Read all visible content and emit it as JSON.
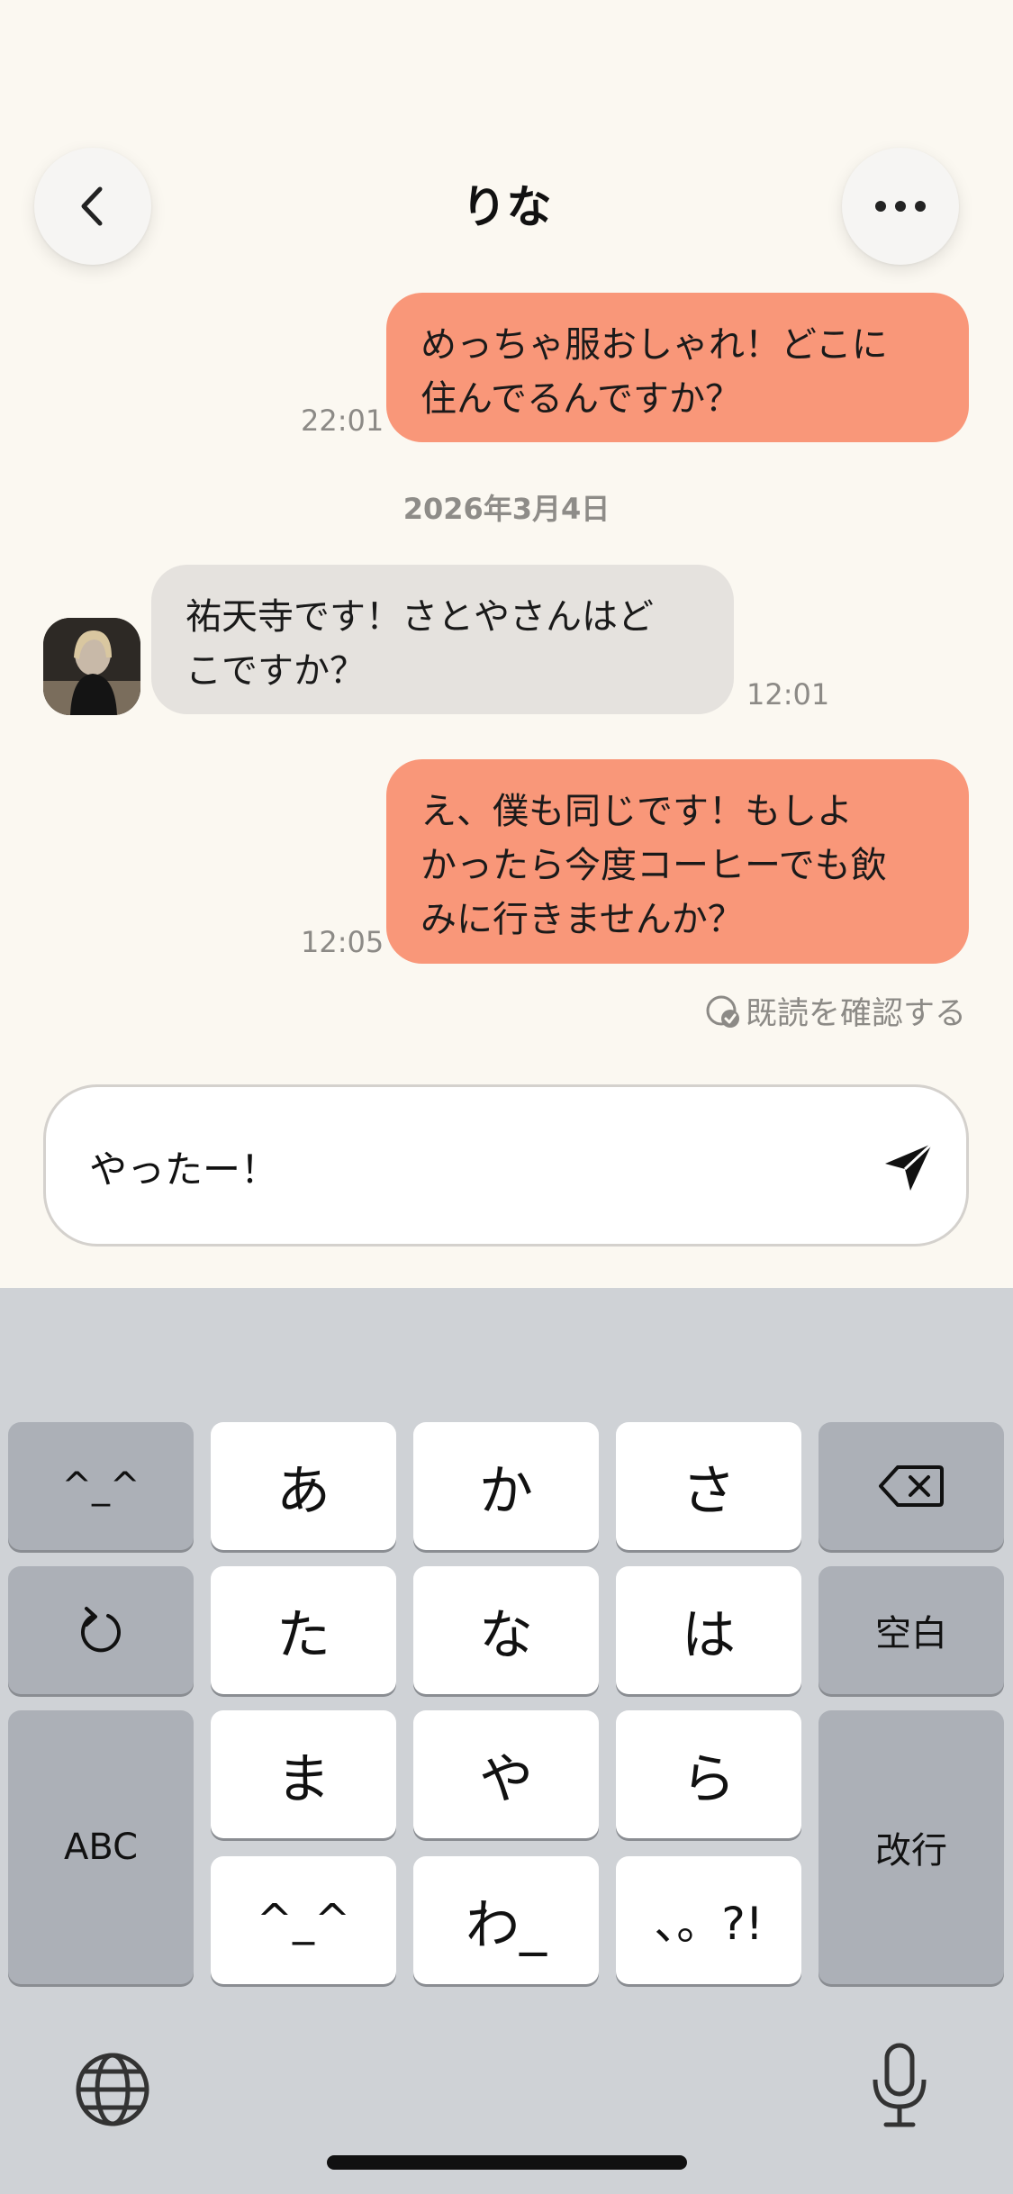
{
  "header": {
    "title": "りな"
  },
  "messages": [
    {
      "id": "m1",
      "direction": "out",
      "text": "めっちゃ服おしゃれ！どこに\n住んでるんですか？",
      "time": "22:01"
    },
    {
      "id": "m2",
      "direction": "in",
      "text": "祐天寺です！さとやさんはど\nこですか？",
      "time": "12:01"
    },
    {
      "id": "m3",
      "direction": "out",
      "text": "え、僕も同じです！もしよ\nかったら今度コーヒーでも飲\nみに行きませんか？",
      "time": "12:05"
    }
  ],
  "date_separator": "2026年3月4日",
  "read_status": "既読を確認する",
  "composer": {
    "value": "やったー！"
  },
  "keyboard": {
    "keys": {
      "emoji": "^_^",
      "a": "あ",
      "ka": "か",
      "sa": "さ",
      "undo": "",
      "ta": "た",
      "na": "な",
      "ha": "は",
      "space": "空白",
      "abc": "ABC",
      "ma": "ま",
      "ya": "や",
      "ra": "ら",
      "enter": "改行",
      "kaomoji": "^_^",
      "wa": "わ_",
      "punct": "、。?!"
    }
  },
  "colors": {
    "background": "#fbf8f1",
    "outgoing_bubble": "#f99779",
    "incoming_bubble": "#e5e2de",
    "keyboard_bg": "#cfd2d6"
  }
}
